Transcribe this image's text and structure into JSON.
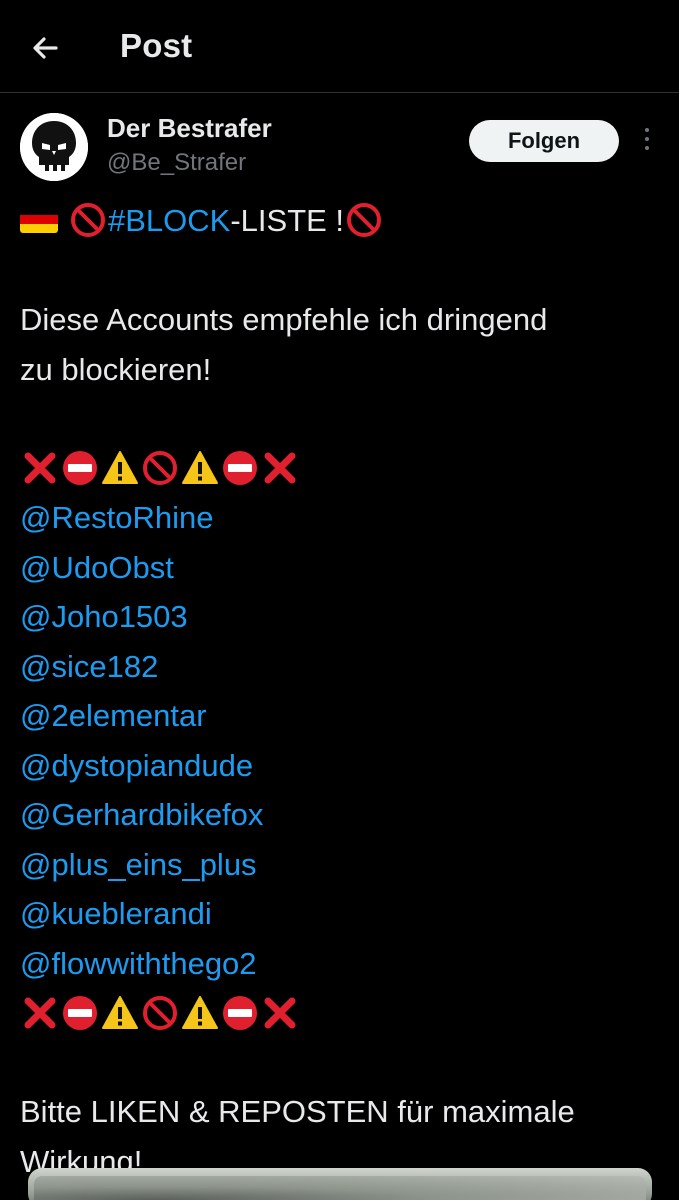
{
  "header": {
    "title": "Post",
    "back_icon": "arrow-left-icon"
  },
  "author": {
    "display_name": "Der Bestrafer",
    "handle": "@Be_Strafer",
    "follow_label": "Folgen",
    "avatar_icon": "punisher-skull-icon",
    "more_icon": "more-vertical-icon"
  },
  "post": {
    "line1": {
      "flag": "germany-flag-icon",
      "hashtag": "#BLOCK",
      "rest": "-LISTE !"
    },
    "intro": [
      "Diese Accounts empfehle ich dringend",
      "zu blockieren!"
    ],
    "emoji_row": [
      "cross-mark-icon",
      "no-entry-icon",
      "warning-icon",
      "prohibited-icon",
      "warning-icon",
      "no-entry-icon",
      "cross-mark-icon"
    ],
    "mentions": [
      "@RestoRhine",
      "@UdoObst",
      "@Joho1503",
      "@sice182",
      "@2elementar",
      "@dystopiandude",
      "@Gerhardbikefox",
      "@plus_eins_plus",
      "@kueblerandi",
      "@flowwiththego2"
    ],
    "outro": [
      "Bitte LIKEN & REPOSTEN für maximale",
      "Wirkung!"
    ]
  },
  "colors": {
    "background": "#000000",
    "text": "#e7e9ea",
    "secondary": "#71767b",
    "link": "#1d9bf0",
    "follow_bg": "#eff3f4"
  }
}
